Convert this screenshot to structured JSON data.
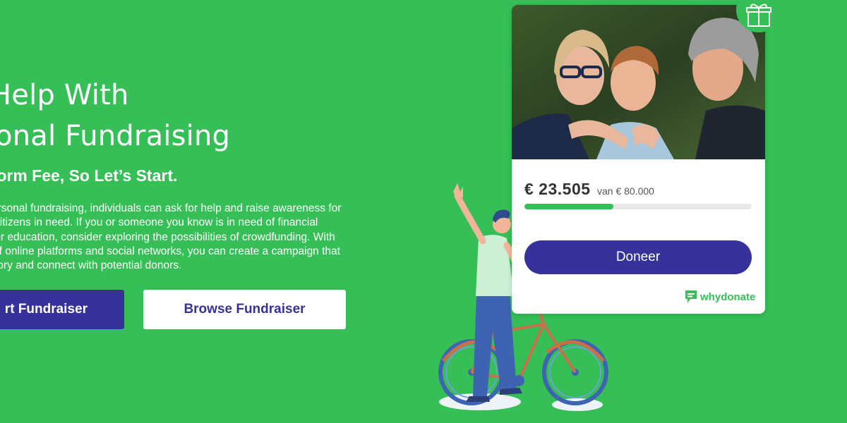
{
  "hero": {
    "title_line1": "Help With",
    "title_line2": "sonal Fundraising",
    "subhead": "tform Fee, So Let’s Start.",
    "paragraph": [
      "ersonal fundraising, individuals can ask for help and raise awareness for",
      "citizens in need. If you or someone you know is in need of financial",
      "for education, consider exploring the possibilities of crowdfunding. With",
      "of online platforms and social networks, you can create a campaign that",
      "tory and connect with potential donors."
    ],
    "start_button": "rt Fundraiser",
    "browse_button": "Browse Fundraiser"
  },
  "card": {
    "amount": "€ 23.505",
    "goal": "van € 80.000",
    "progress": 0.39,
    "donate_button": "Doneer",
    "brand_why": "why",
    "brand_donate": "donate",
    "badge_icon": "gift-icon",
    "brand_icon": "chat-bubble-icon"
  },
  "colors": {
    "background": "#35bf56",
    "primary": "#37319b",
    "white": "#ffffff"
  }
}
